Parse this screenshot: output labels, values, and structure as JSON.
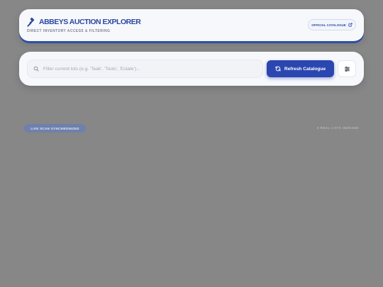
{
  "header": {
    "title": "ABBEYS AUCTION EXPLORER",
    "subtitle": "DIRECT INVENTORY ACCESS & FILTERING",
    "brand_icon": "gavel-icon",
    "official_label": "OFFICIAL CATALOGUE",
    "official_icon": "external-link-icon"
  },
  "search": {
    "placeholder": "Filter current lots (e.g. 'Teak', 'Tools', 'Estate')...",
    "value": "",
    "icon": "search-icon"
  },
  "actions": {
    "refresh_label": "Refresh Catalogue",
    "refresh_icon": "refresh-icon",
    "filter_icon": "sliders-icon"
  },
  "status": {
    "live_label": "LIVE SCAN SYNCHRONIZED",
    "lot_count_text": "0 REAL LOTS INDEXED"
  },
  "colors": {
    "background": "#878787",
    "card": "#f7f8fb",
    "accent": "#2a46b0",
    "badge": "#6f80ad"
  }
}
